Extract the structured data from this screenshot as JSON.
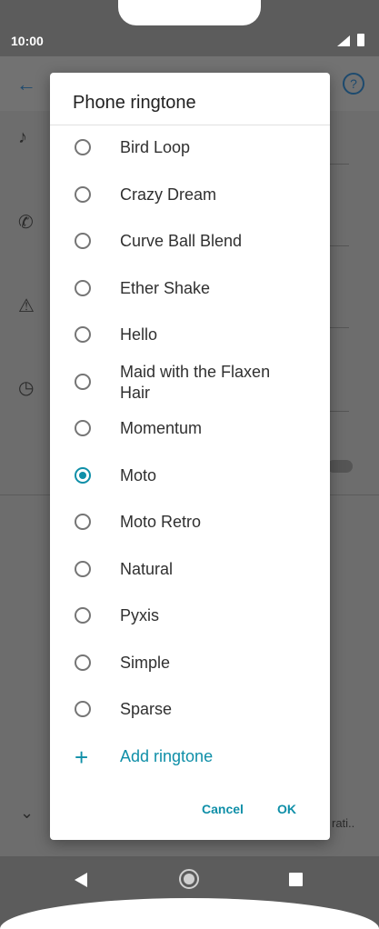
{
  "status_bar": {
    "time": "10:00"
  },
  "background": {
    "truncated_text": "rati.."
  },
  "dialog": {
    "title": "Phone ringtone",
    "options": [
      {
        "label": "Bird Loop",
        "selected": false
      },
      {
        "label": "Crazy Dream",
        "selected": false
      },
      {
        "label": "Curve Ball Blend",
        "selected": false
      },
      {
        "label": "Ether Shake",
        "selected": false
      },
      {
        "label": "Hello",
        "selected": false
      },
      {
        "label": "Maid with the Flaxen Hair",
        "selected": false
      },
      {
        "label": "Momentum",
        "selected": false
      },
      {
        "label": "Moto",
        "selected": true
      },
      {
        "label": "Moto Retro",
        "selected": false
      },
      {
        "label": "Natural",
        "selected": false
      },
      {
        "label": "Pyxis",
        "selected": false
      },
      {
        "label": "Simple",
        "selected": false
      },
      {
        "label": "Sparse",
        "selected": false
      }
    ],
    "add_ringtone_label": "Add ringtone",
    "cancel_label": "Cancel",
    "ok_label": "OK"
  },
  "colors": {
    "accent": "#0f8fa8",
    "scrim": "#6d6d6d"
  },
  "icons": [
    "back-arrow-icon",
    "help-icon",
    "music-note-icon",
    "phone-icon",
    "bell-icon",
    "alarm-icon",
    "chevron-down-icon",
    "add-icon",
    "nav-back-icon",
    "nav-home-icon",
    "nav-recents-icon"
  ]
}
